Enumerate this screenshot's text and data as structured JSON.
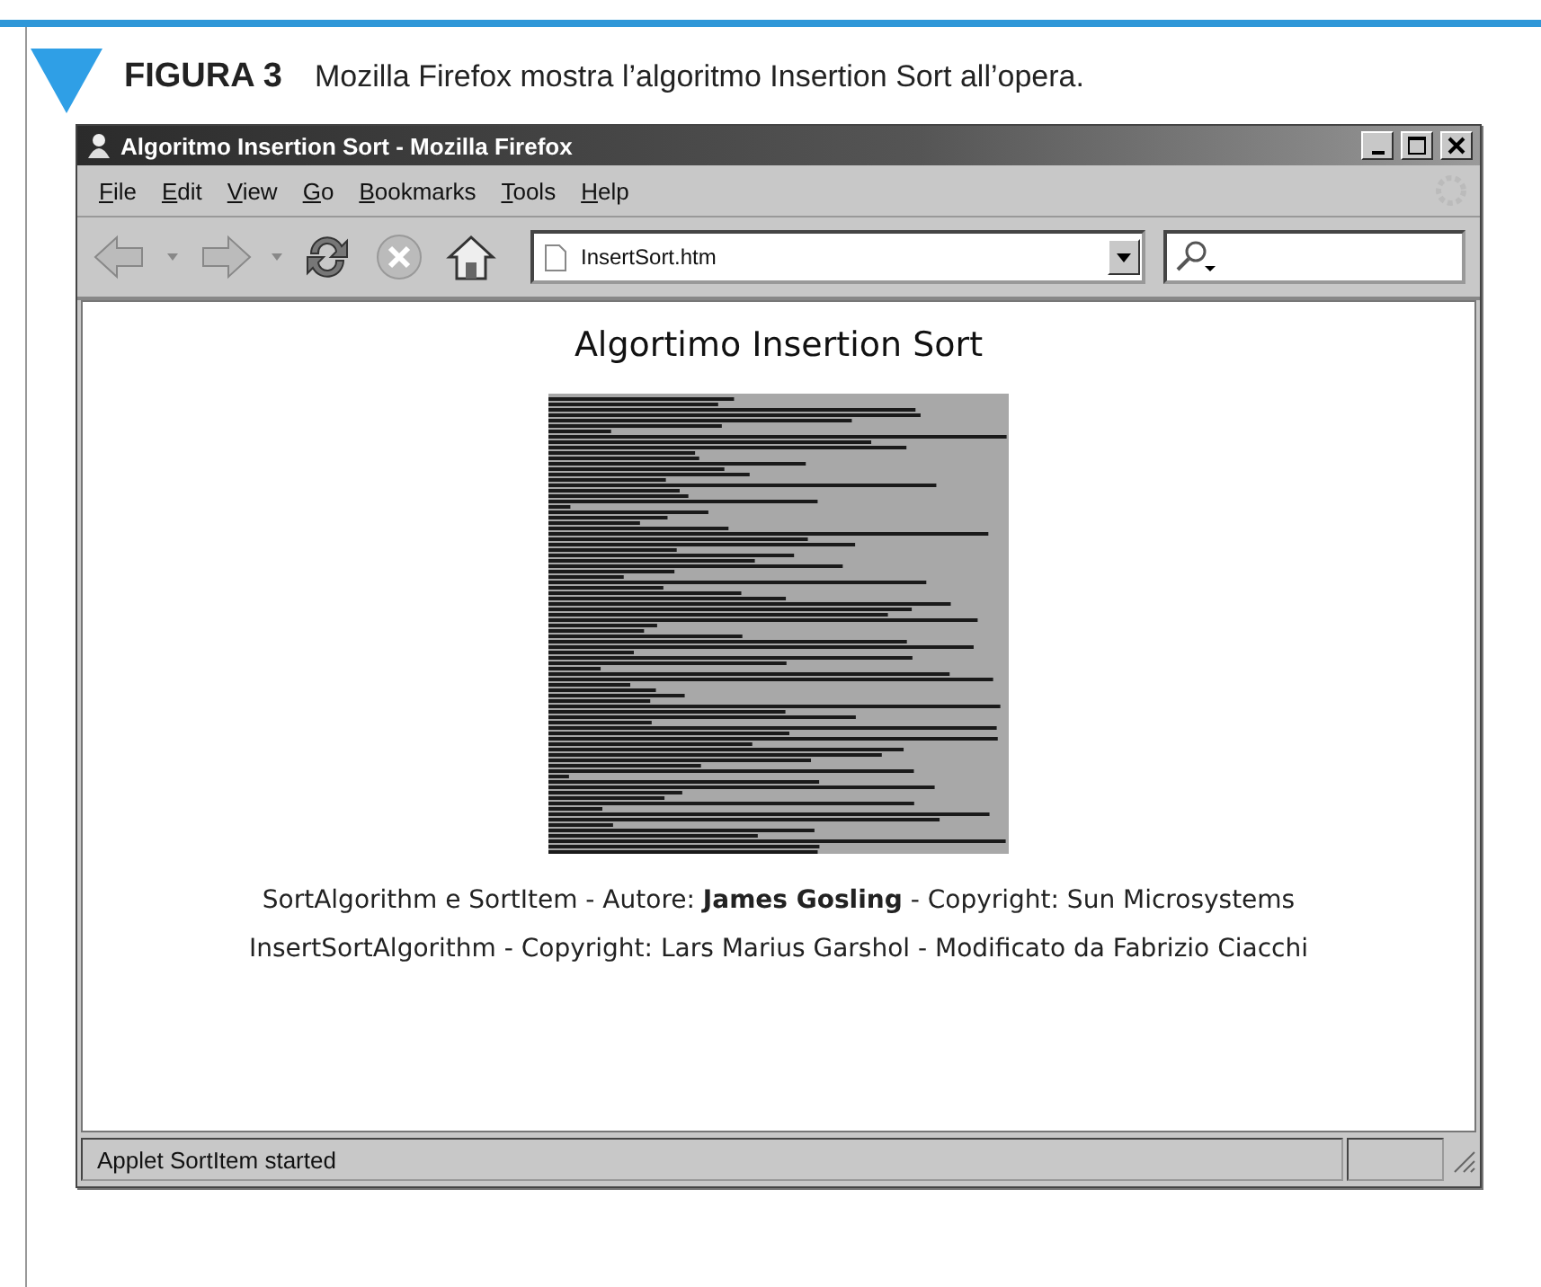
{
  "figure": {
    "label": "FIGURA 3",
    "caption": "Mozilla Firefox mostra l’algoritmo Insertion Sort all’opera."
  },
  "window": {
    "title": "Algoritmo Insertion Sort - Mozilla Firefox"
  },
  "menu": [
    "File",
    "Edit",
    "View",
    "Go",
    "Bookmarks",
    "Tools",
    "Help"
  ],
  "address": {
    "value": "InsertSort.htm"
  },
  "page": {
    "heading": "Algortimo Insertion Sort",
    "credits": [
      "SortAlgorithm e SortItem - Autore: **James Gosling** - Copyright: Sun Microsystems",
      "InsertSortAlgorithm - Copyright: Lars Marius Garshol - Modificato da Fabrizio Ciacchi"
    ]
  },
  "status_bar": {
    "text": "Applet SortItem started"
  }
}
